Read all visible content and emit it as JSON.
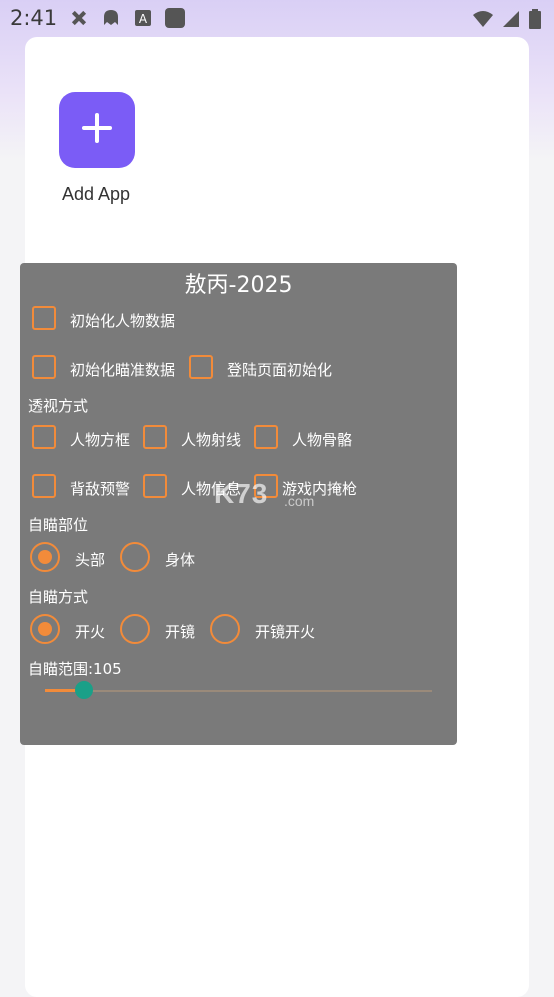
{
  "status_bar": {
    "time": "2:41",
    "left_icons": [
      "no-sim-icon",
      "ghost-icon",
      "a-badge-icon",
      "square-app-icon"
    ],
    "right_icons": [
      "wifi-icon",
      "signal-icon",
      "battery-icon"
    ]
  },
  "launcher": {
    "add_app_label": "Add App",
    "add_icon": "plus-icon",
    "accent": "#7b5cf6"
  },
  "overlay": {
    "title": "敖丙-2025",
    "init_checkboxes": [
      {
        "label": "初始化人物数据",
        "checked": false
      },
      {
        "label": "初始化瞄准数据",
        "checked": false
      },
      {
        "label": "登陆页面初始化",
        "checked": false
      }
    ],
    "esp_section": "透视方式",
    "esp_options": [
      {
        "label": "人物方框",
        "checked": false
      },
      {
        "label": "人物射线",
        "checked": false
      },
      {
        "label": "人物骨骼",
        "checked": false
      },
      {
        "label": "背敌预警",
        "checked": false
      },
      {
        "label": "人物信息",
        "checked": false
      },
      {
        "label": "游戏内掩枪",
        "checked": false
      }
    ],
    "aim_part_section": "自瞄部位",
    "aim_part_options": [
      {
        "label": "头部",
        "selected": true
      },
      {
        "label": "身体",
        "selected": false
      }
    ],
    "aim_mode_section": "自瞄方式",
    "aim_mode_options": [
      {
        "label": "开火",
        "selected": true
      },
      {
        "label": "开镜",
        "selected": false
      },
      {
        "label": "开镜开火",
        "selected": false
      }
    ],
    "aim_range_label": "自瞄范围:105",
    "aim_range_value": 105,
    "aim_range_fraction": 0.1,
    "accent": "#f28b3a",
    "thumb_color": "#1aa088"
  },
  "watermark": {
    "main": "K73",
    "sub": ".com"
  }
}
